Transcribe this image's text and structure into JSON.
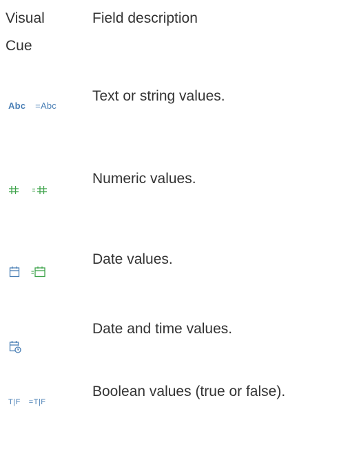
{
  "header": {
    "visual_cue": "Visual Cue",
    "field_description": "Field description"
  },
  "rows": [
    {
      "description": "Text or string values.",
      "icons": [
        {
          "name": "text-icon",
          "label": "Abc",
          "color": "#4a7fb5"
        },
        {
          "name": "calculated-text-icon",
          "label": "=Abc",
          "color": "#4a7fb5"
        }
      ]
    },
    {
      "description": "Numeric values.",
      "icons": [
        {
          "name": "number-icon",
          "label": "#",
          "color": "#3ea34b"
        },
        {
          "name": "calculated-number-icon",
          "label": "=#",
          "color": "#3ea34b"
        }
      ]
    },
    {
      "description": "Date values.",
      "icons": [
        {
          "name": "date-icon",
          "color": "#4a7fb5"
        },
        {
          "name": "calculated-date-icon",
          "color": "#3ea34b"
        }
      ]
    },
    {
      "description": "Date and time values.",
      "icons": [
        {
          "name": "datetime-icon",
          "color": "#4a7fb5"
        }
      ]
    },
    {
      "description": "Boolean values (true or false).",
      "icons": [
        {
          "name": "boolean-icon",
          "label": "T|F",
          "color": "#4a7fb5"
        },
        {
          "name": "calculated-boolean-icon",
          "label": "=T|F",
          "color": "#4a7fb5"
        }
      ]
    }
  ]
}
